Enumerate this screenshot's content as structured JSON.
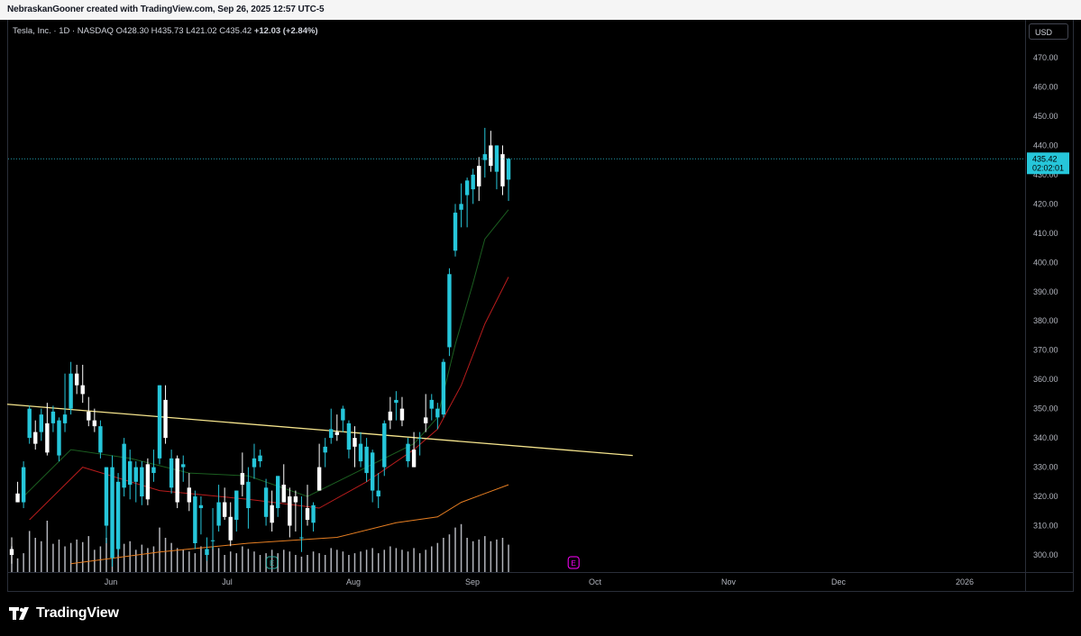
{
  "header": {
    "caption": "NebraskanGooner created with TradingView.com, Sep 26, 2025 12:57 UTC-5"
  },
  "legend": {
    "symbol": "Tesla, Inc. · 1D · NASDAQ",
    "open_label": "O",
    "open": "428.30",
    "high_label": "H",
    "high": "435.73",
    "low_label": "L",
    "low": "421.02",
    "close_label": "C",
    "close": "435.42",
    "change": "+12.03 (+2.84%)"
  },
  "currency": "USD",
  "price_tag": {
    "price": "435.42",
    "countdown": "02:02:01"
  },
  "footer": {
    "brand": "TradingView"
  },
  "colors": {
    "up": "#26c6da",
    "down": "#ffffff",
    "trendline": "#f6e58d",
    "ema_green": "#1b5e20",
    "ema_red": "#b71c1c",
    "ema_orange": "#e67e22",
    "volume": "#d1d4dc",
    "earnings": "#ff00ff"
  },
  "chart_data": {
    "type": "candlestick",
    "ylim": [
      295,
      478
    ],
    "y_ticks": [
      "470.00",
      "460.00",
      "450.00",
      "440.00",
      "430.00",
      "420.00",
      "410.00",
      "400.00",
      "390.00",
      "380.00",
      "370.00",
      "360.00",
      "350.00",
      "340.00",
      "330.00",
      "320.00",
      "310.00",
      "300.00"
    ],
    "x_ticks": [
      "Jun",
      "Jul",
      "Aug",
      "Sep",
      "Oct",
      "Nov",
      "Dec",
      "2026"
    ],
    "candles": [
      [
        302,
        306,
        297,
        300
      ],
      [
        321,
        325,
        318,
        318
      ],
      [
        318,
        332,
        316,
        330
      ],
      [
        340,
        351,
        338,
        350
      ],
      [
        342,
        346,
        336,
        338
      ],
      [
        342,
        350,
        339,
        348
      ],
      [
        345,
        352,
        334,
        335
      ],
      [
        345,
        351,
        342,
        349
      ],
      [
        334,
        347,
        332,
        346
      ],
      [
        345,
        362,
        342,
        348
      ],
      [
        350,
        366,
        348,
        362
      ],
      [
        362,
        365,
        355,
        358
      ],
      [
        358,
        365,
        352,
        355
      ],
      [
        349,
        354,
        344,
        346
      ],
      [
        346,
        350,
        342,
        344
      ],
      [
        335,
        346,
        333,
        344
      ],
      [
        310,
        330,
        304,
        330
      ],
      [
        299,
        334,
        296,
        330
      ],
      [
        302,
        328,
        300,
        325
      ],
      [
        323,
        340,
        320,
        338
      ],
      [
        324,
        336,
        319,
        332
      ],
      [
        325,
        332,
        318,
        330
      ],
      [
        320,
        332,
        317,
        330
      ],
      [
        331,
        333,
        317,
        319
      ],
      [
        328,
        336,
        325,
        330
      ],
      [
        333,
        358,
        331,
        358
      ],
      [
        353,
        358,
        338,
        340
      ],
      [
        323,
        336,
        321,
        333
      ],
      [
        333,
        334,
        316,
        318
      ],
      [
        330,
        334,
        325,
        331
      ],
      [
        323,
        328,
        315,
        318
      ],
      [
        304,
        322,
        302,
        320
      ],
      [
        316,
        320,
        307,
        317
      ],
      [
        300,
        306,
        298,
        302
      ],
      [
        305,
        316,
        302,
        305
      ],
      [
        310,
        324,
        308,
        318
      ],
      [
        318,
        323,
        312,
        313
      ],
      [
        313,
        318,
        303,
        305
      ],
      [
        312,
        322,
        308,
        322
      ],
      [
        328,
        335,
        320,
        324
      ],
      [
        316,
        330,
        309,
        325
      ],
      [
        330,
        338,
        326,
        333
      ],
      [
        332,
        336,
        330,
        334
      ],
      [
        313,
        326,
        310,
        323
      ],
      [
        317,
        322,
        308,
        311
      ],
      [
        316,
        327,
        313,
        327
      ],
      [
        324,
        331,
        318,
        318
      ],
      [
        320,
        323,
        306,
        310
      ],
      [
        320,
        322,
        308,
        318
      ],
      [
        306,
        320,
        301,
        306
      ],
      [
        316,
        324,
        310,
        312
      ],
      [
        311,
        318,
        308,
        317
      ],
      [
        330,
        338,
        322,
        322
      ],
      [
        335,
        340,
        330,
        337
      ],
      [
        340,
        350,
        338,
        343
      ],
      [
        342,
        348,
        339,
        341
      ],
      [
        346,
        351,
        342,
        350
      ],
      [
        336,
        346,
        333,
        345
      ],
      [
        340,
        344,
        330,
        337
      ],
      [
        332,
        342,
        330,
        338
      ],
      [
        328,
        340,
        325,
        337
      ],
      [
        322,
        336,
        318,
        335
      ],
      [
        320,
        328,
        316,
        322
      ],
      [
        330,
        346,
        327,
        345
      ],
      [
        349,
        354,
        343,
        346
      ],
      [
        352,
        356,
        346,
        353
      ],
      [
        350,
        354,
        344,
        346
      ],
      [
        332,
        340,
        330,
        338
      ],
      [
        336,
        342,
        330,
        330
      ],
      [
        340,
        342,
        334,
        340
      ],
      [
        347,
        355,
        342,
        345
      ],
      [
        350,
        355,
        346,
        353
      ],
      [
        347,
        352,
        343,
        350
      ],
      [
        348,
        367,
        347,
        366
      ],
      [
        371,
        398,
        368,
        396
      ],
      [
        404,
        420,
        402,
        417
      ],
      [
        418,
        427,
        412,
        420
      ],
      [
        423,
        429,
        412,
        428
      ],
      [
        425,
        432,
        420,
        430
      ],
      [
        433,
        436,
        421,
        426
      ],
      [
        435,
        446,
        429,
        437
      ],
      [
        440,
        445,
        431,
        433
      ],
      [
        431,
        440,
        425,
        440
      ],
      [
        437,
        440,
        423,
        426
      ],
      [
        428.3,
        435.73,
        421.02,
        435.42
      ]
    ],
    "volume_relative": [
      0.3,
      0.16,
      0.22,
      0.48,
      0.4,
      0.36,
      0.6,
      0.33,
      0.38,
      0.3,
      0.34,
      0.38,
      0.35,
      0.42,
      0.26,
      0.3,
      0.4,
      0.62,
      0.58,
      0.33,
      0.36,
      0.26,
      0.32,
      0.28,
      0.3,
      0.52,
      0.4,
      0.34,
      0.28,
      0.26,
      0.24,
      0.22,
      0.3,
      0.26,
      0.3,
      0.28,
      0.2,
      0.24,
      0.22,
      0.3,
      0.27,
      0.24,
      0.2,
      0.22,
      0.26,
      0.22,
      0.26,
      0.24,
      0.2,
      0.18,
      0.2,
      0.24,
      0.22,
      0.2,
      0.28,
      0.26,
      0.24,
      0.2,
      0.22,
      0.24,
      0.26,
      0.28,
      0.22,
      0.26,
      0.3,
      0.28,
      0.26,
      0.24,
      0.28,
      0.22,
      0.26,
      0.3,
      0.34,
      0.4,
      0.44,
      0.52,
      0.56,
      0.4,
      0.36,
      0.38,
      0.42,
      0.36,
      0.38,
      0.4,
      0.32
    ],
    "trendline": {
      "start": [
        0,
        351.5
      ],
      "end": [
        105,
        334.0
      ]
    },
    "ema_fast": [
      [
        2,
        320
      ],
      [
        10,
        336
      ],
      [
        20,
        333
      ],
      [
        30,
        328
      ],
      [
        40,
        327
      ],
      [
        50,
        320
      ],
      [
        60,
        330
      ],
      [
        68,
        338
      ],
      [
        72,
        347
      ],
      [
        75,
        372
      ],
      [
        78,
        393
      ],
      [
        80,
        408
      ],
      [
        84,
        418
      ]
    ],
    "ema_slow": [
      [
        3,
        312
      ],
      [
        12,
        330
      ],
      [
        25,
        322
      ],
      [
        40,
        319
      ],
      [
        52,
        316
      ],
      [
        60,
        325
      ],
      [
        68,
        336
      ],
      [
        72,
        343
      ],
      [
        76,
        358
      ],
      [
        80,
        379
      ],
      [
        84,
        395
      ]
    ],
    "sma_long": [
      [
        10,
        297
      ],
      [
        25,
        301
      ],
      [
        40,
        304
      ],
      [
        55,
        306
      ],
      [
        65,
        311
      ],
      [
        72,
        313
      ],
      [
        76,
        318
      ],
      [
        80,
        321
      ],
      [
        84,
        324
      ]
    ],
    "earnings_markers": [
      44,
      95
    ]
  }
}
